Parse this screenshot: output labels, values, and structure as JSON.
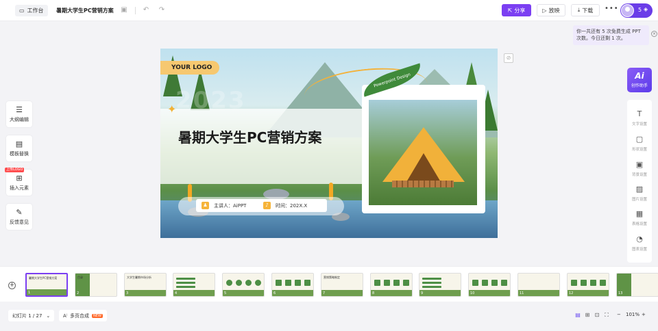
{
  "toolbar": {
    "workbench_label": "工作台",
    "doc_title": "暑期大学生PC营销方案",
    "share_label": "分享",
    "play_label": "放映",
    "download_label": "下载",
    "more_label": "•••",
    "credits": "5"
  },
  "tip": {
    "text": "你一共还有 5 次免费生成 PPT 次数。今日还剩 1 次。"
  },
  "left_tools": [
    {
      "label": "大纲编辑",
      "icon": "outline-icon"
    },
    {
      "label": "模板替换",
      "icon": "template-icon"
    },
    {
      "label": "插入元素",
      "icon": "insert-icon",
      "tag": "上传LOGO"
    },
    {
      "label": "反馈意见",
      "icon": "feedback-icon"
    }
  ],
  "slide": {
    "logo_text": "YOUR LOGO",
    "ghost_year": "2023",
    "title": "暑期大学生PC营销方案",
    "tag_text": "Powerpoint Design",
    "presenter": "主讲人：AiPPT",
    "time": "时间：202X.X"
  },
  "ai_assistant": {
    "icon_text": "Ai",
    "label": "创作助手"
  },
  "right_panel": [
    {
      "label": "文字设置",
      "icon": "T"
    },
    {
      "label": "形状设置",
      "icon": "▢"
    },
    {
      "label": "背景设置",
      "icon": "▣"
    },
    {
      "label": "图片设置",
      "icon": "▨"
    },
    {
      "label": "表格设置",
      "icon": "▦"
    },
    {
      "label": "图表设置",
      "icon": "◔"
    }
  ],
  "thumbnails": [
    {
      "num": "1",
      "title": "暑期大学生PC营销方案",
      "style": "cover"
    },
    {
      "num": "2",
      "title": "目录",
      "style": "green"
    },
    {
      "num": "3",
      "title": "大学生暑期市场分析",
      "style": "cover"
    },
    {
      "num": "4",
      "title": "",
      "style": "list"
    },
    {
      "num": "5",
      "title": "",
      "style": "icons"
    },
    {
      "num": "6",
      "title": "",
      "style": "cols"
    },
    {
      "num": "7",
      "title": "营销策略制定",
      "style": "cover"
    },
    {
      "num": "8",
      "title": "",
      "style": "boxes"
    },
    {
      "num": "9",
      "title": "",
      "style": "list"
    },
    {
      "num": "10",
      "title": "",
      "style": "cols"
    },
    {
      "num": "11",
      "title": "",
      "style": "cover"
    },
    {
      "num": "12",
      "title": "",
      "style": "boxes"
    },
    {
      "num": "13",
      "title": "",
      "style": "green"
    }
  ],
  "bottom": {
    "page_indicator": "幻灯片 1 / 27",
    "merge_label": "多页合成",
    "new_badge": "NEW",
    "zoom_minus": "−",
    "zoom_value": "101%",
    "zoom_plus": "+"
  },
  "colors": {
    "accent": "#7b3ff2",
    "brand_orange": "#f6b43a",
    "brand_green": "#3f8a3a"
  }
}
